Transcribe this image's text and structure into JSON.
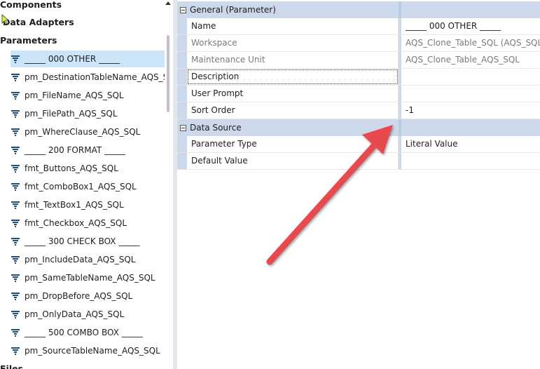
{
  "tree": {
    "headers": {
      "components": "Components",
      "data_adapters": "Data Adapters",
      "parameters": "Parameters",
      "files": "Files"
    },
    "parameters": [
      "_____ 000 OTHER _____",
      "pm_DestinationTableName_AQS_S",
      "pm_FileName_AQS_SQL",
      "pm_FilePath_AQS_SQL",
      "pm_WhereClause_AQS_SQL",
      "_____ 200 FORMAT _____",
      "fmt_Buttons_AQS_SQL",
      "fmt_ComboBox1_AQS_SQL",
      "fmt_TextBox1_AQS_SQL",
      "fmt_Checkbox_AQS_SQL",
      "_____ 300 CHECK BOX _____",
      "pm_IncludeData_AQS_SQL",
      "pm_SameTableName_AQS_SQL",
      "pm_DropBefore_AQS_SQL",
      "pm_OnlyData_AQS_SQL",
      "_____ 500 COMBO BOX _____",
      "pm_SourceTableName_AQS_SQL"
    ],
    "selected_index": 0
  },
  "grid": {
    "general": {
      "label": "General (Parameter)",
      "rows": [
        {
          "name": "Name",
          "value": "_____ 000 OTHER _____",
          "name_muted": false,
          "value_muted": false
        },
        {
          "name": "Workspace",
          "value": "AQS_Clone_Table_SQL (AQS_SQL)",
          "name_muted": true,
          "value_muted": true
        },
        {
          "name": "Maintenance Unit",
          "value": "AQS_Clone_Table_AQS_SQL",
          "name_muted": true,
          "value_muted": true
        },
        {
          "name": "Description",
          "value": "",
          "name_muted": false,
          "value_muted": false
        },
        {
          "name": "User Prompt",
          "value": "",
          "name_muted": false,
          "value_muted": false
        },
        {
          "name": "Sort Order",
          "value": "-1",
          "name_muted": false,
          "value_muted": false
        }
      ]
    },
    "data_source": {
      "label": "Data Source",
      "rows": [
        {
          "name": "Parameter Type",
          "value": "Literal Value",
          "name_muted": false,
          "value_muted": false
        },
        {
          "name": "Default Value",
          "value": "",
          "name_muted": false,
          "value_muted": false
        }
      ]
    }
  },
  "colors": {
    "category_bg": "#ccd9ea",
    "selection_bg": "#cce4f7",
    "arrow": "#e8484e",
    "filter_icon": "#1f4e79"
  }
}
